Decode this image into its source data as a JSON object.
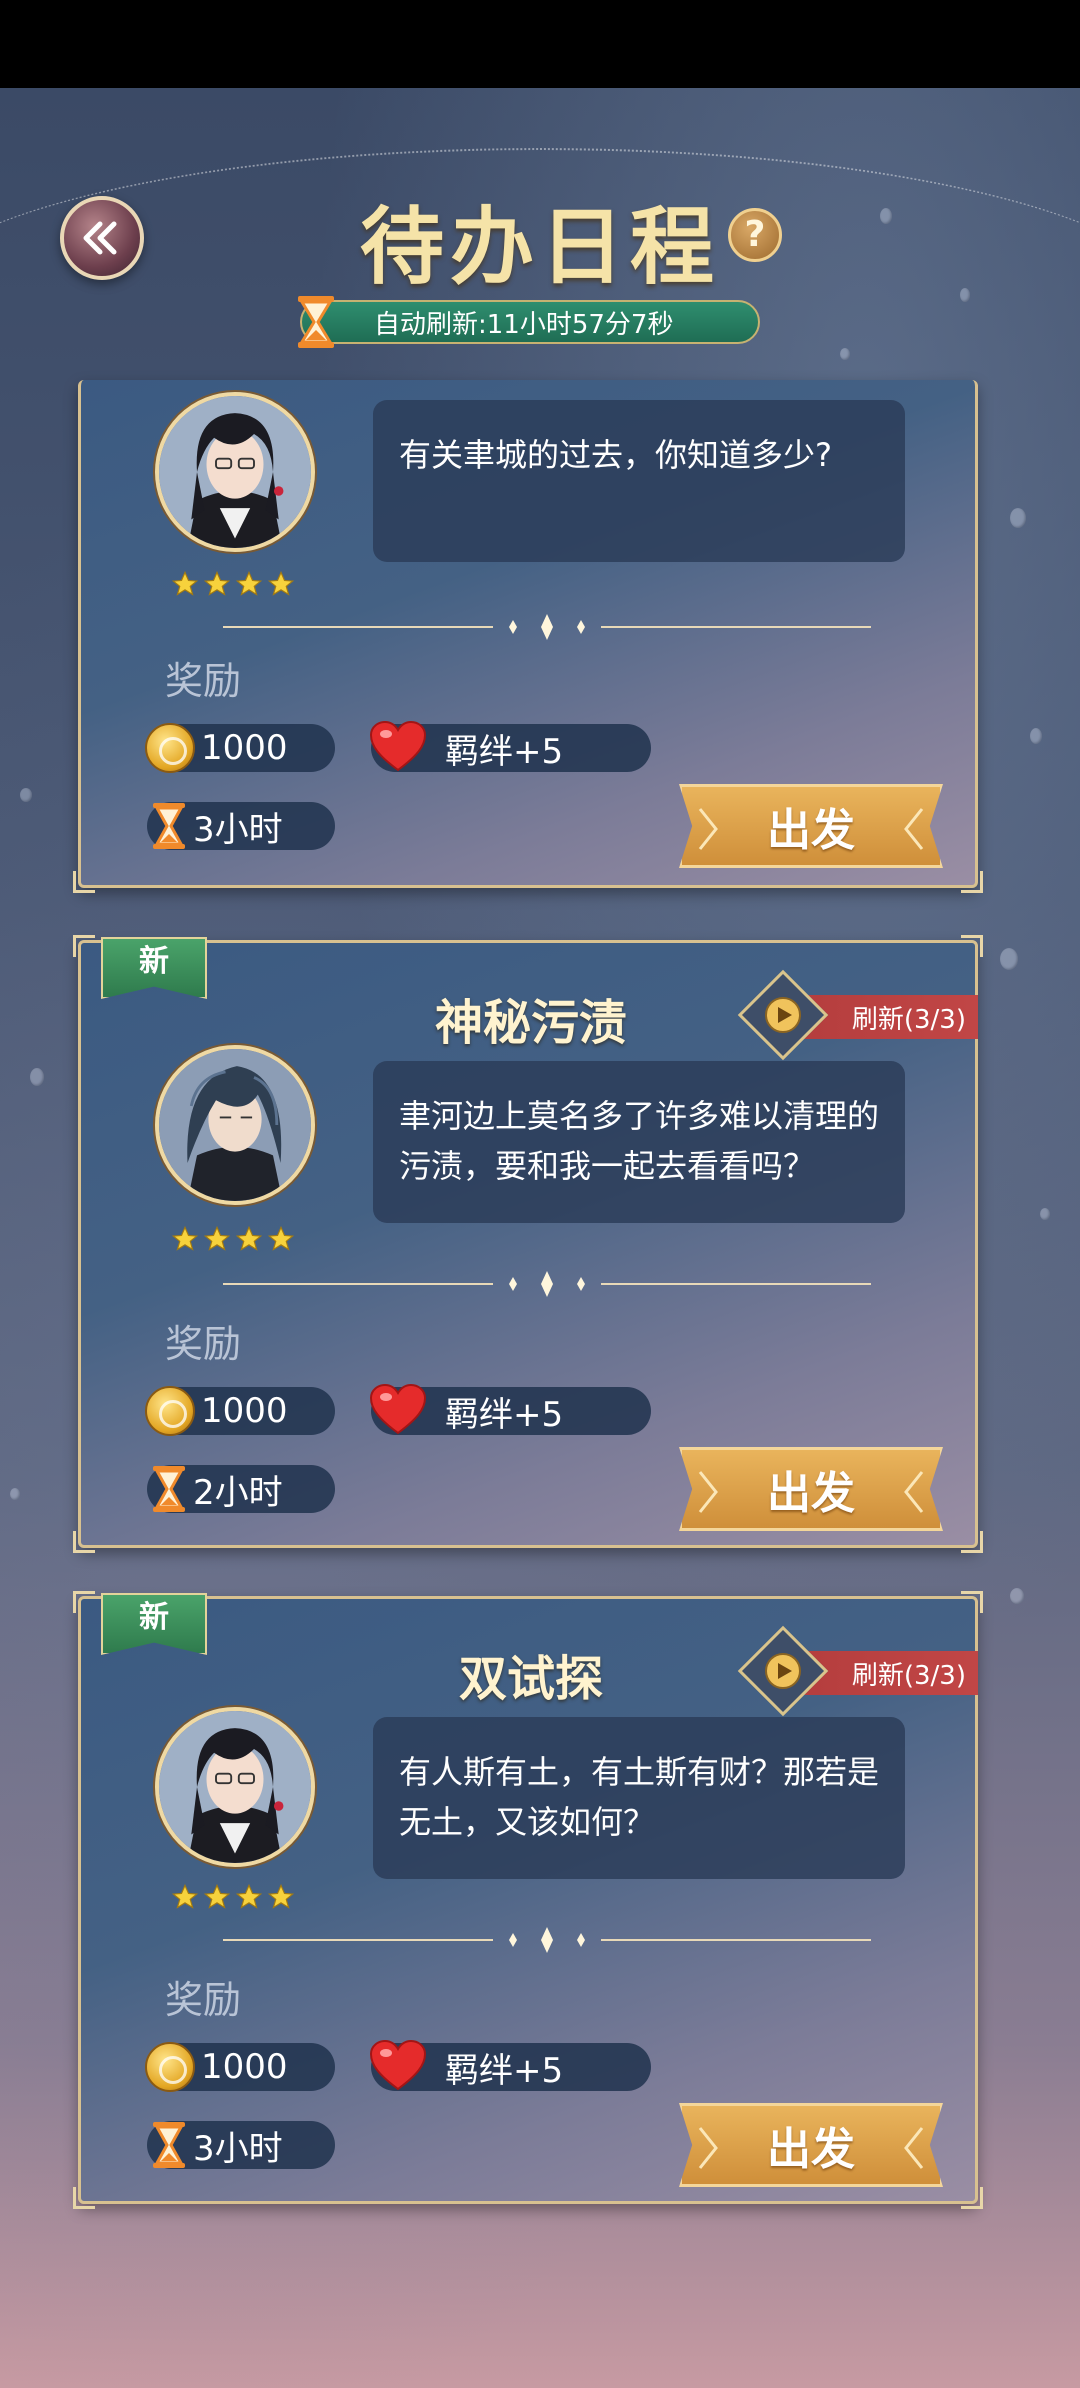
{
  "header": {
    "title": "待办日程",
    "help_label": "?",
    "auto_refresh_text": "自动刷新:11小时57分7秒"
  },
  "cards": [
    {
      "is_new": false,
      "title": "",
      "refresh_label": "",
      "stars": 4,
      "dialog": "有关聿城的过去，你知道多少?",
      "reward_label": "奖励",
      "coins": "1000",
      "bond": "羁绊+5",
      "duration": "3小时",
      "go_label": "出发"
    },
    {
      "is_new": true,
      "new_label": "新",
      "title": "神秘污渍",
      "refresh_label": "刷新(3/3)",
      "stars": 4,
      "dialog": "聿河边上莫名多了许多难以清理的污渍，要和我一起去看看吗？",
      "reward_label": "奖励",
      "coins": "1000",
      "bond": "羁绊+5",
      "duration": "2小时",
      "go_label": "出发"
    },
    {
      "is_new": true,
      "new_label": "新",
      "title": "双试探",
      "refresh_label": "刷新(3/3)",
      "stars": 4,
      "dialog": "有人斯有土，有土斯有财？那若是无土，又该如何？",
      "reward_label": "奖励",
      "coins": "1000",
      "bond": "羁绊+5",
      "duration": "3小时",
      "go_label": "出发"
    }
  ],
  "colors": {
    "title_gold": "#f5e3a8",
    "refresh_green": "#2f8e6f",
    "tag_red": "#b43d3d",
    "button_gold": "#e9b45c"
  },
  "icons": [
    "back-arrow-icon",
    "help-icon",
    "hourglass-icon",
    "coin-icon",
    "heart-icon",
    "play-icon",
    "star-icon"
  ]
}
